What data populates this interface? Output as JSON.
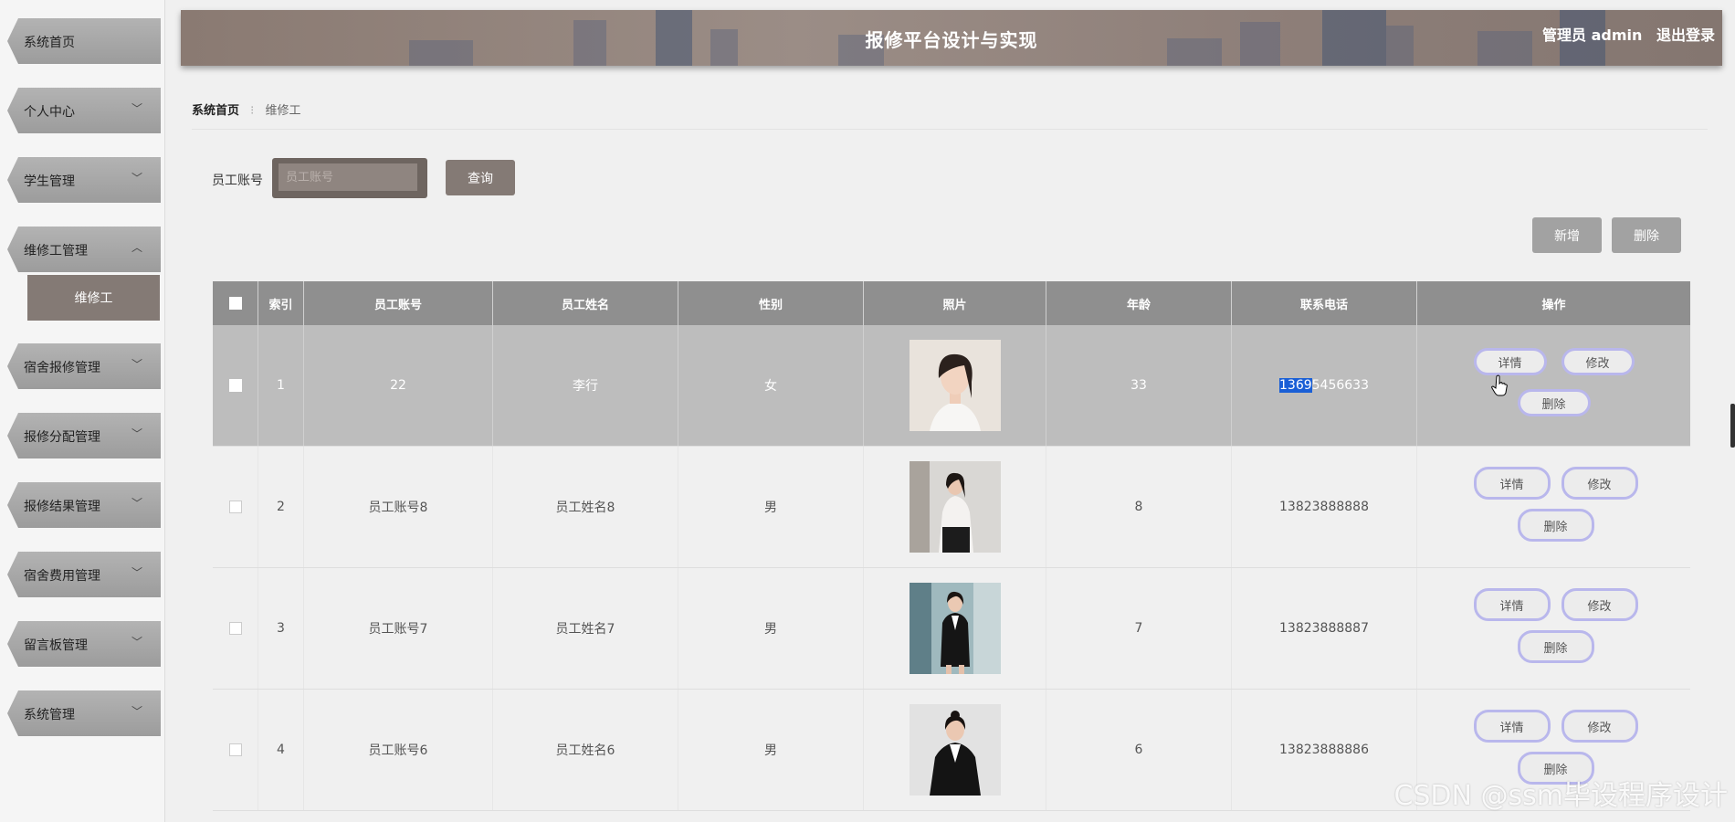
{
  "sidebar": {
    "items": [
      {
        "label": "系统首页",
        "chevron": ""
      },
      {
        "label": "个人中心",
        "chevron": "chevron-down"
      },
      {
        "label": "学生管理",
        "chevron": "chevron-down"
      },
      {
        "label": "维修工管理",
        "chevron": "chevron-up"
      },
      {
        "label": "宿舍报修管理",
        "chevron": "chevron-down"
      },
      {
        "label": "报修分配管理",
        "chevron": "chevron-down"
      },
      {
        "label": "报修结果管理",
        "chevron": "chevron-down"
      },
      {
        "label": "宿舍费用管理",
        "chevron": "chevron-down"
      },
      {
        "label": "留言板管理",
        "chevron": "chevron-down"
      },
      {
        "label": "系统管理",
        "chevron": "chevron-down"
      }
    ],
    "active_sub": "维修工"
  },
  "header": {
    "title": "报修平台设计与实现",
    "user": "管理员 admin",
    "logout": "退出登录"
  },
  "breadcrumb": {
    "home": "系统首页",
    "current": "维修工"
  },
  "search": {
    "label": "员工账号",
    "placeholder": "员工账号",
    "value": "",
    "button": "查询"
  },
  "actions": {
    "add": "新增",
    "delete": "删除"
  },
  "table": {
    "headers": {
      "index": "索引",
      "account": "员工账号",
      "name": "员工姓名",
      "gender": "性别",
      "photo": "照片",
      "age": "年龄",
      "phone": "联系电话",
      "ops": "操作"
    },
    "rows": [
      {
        "index": "1",
        "account": "22",
        "name": "李行",
        "gender": "女",
        "age": "33",
        "phone_selected": "1369",
        "phone_rest": "5456633",
        "highlighted": true
      },
      {
        "index": "2",
        "account": "员工账号8",
        "name": "员工姓名8",
        "gender": "男",
        "age": "8",
        "phone_selected": "",
        "phone_rest": "13823888888",
        "highlighted": false
      },
      {
        "index": "3",
        "account": "员工账号7",
        "name": "员工姓名7",
        "gender": "男",
        "age": "7",
        "phone_selected": "",
        "phone_rest": "13823888887",
        "highlighted": false
      },
      {
        "index": "4",
        "account": "员工账号6",
        "name": "员工姓名6",
        "gender": "男",
        "age": "6",
        "phone_selected": "",
        "phone_rest": "13823888886",
        "highlighted": false
      }
    ],
    "row_buttons": {
      "detail": "详情",
      "edit": "修改",
      "delete": "删除"
    }
  },
  "watermark": "CSDN @ssm毕设程序设计",
  "colors": {
    "accent": "#847a75",
    "header_bg": "#8f8f8f",
    "highlight_row": "#bdbdbd",
    "button_border": "#b9b7ec",
    "selection": "#1a5fd6"
  }
}
